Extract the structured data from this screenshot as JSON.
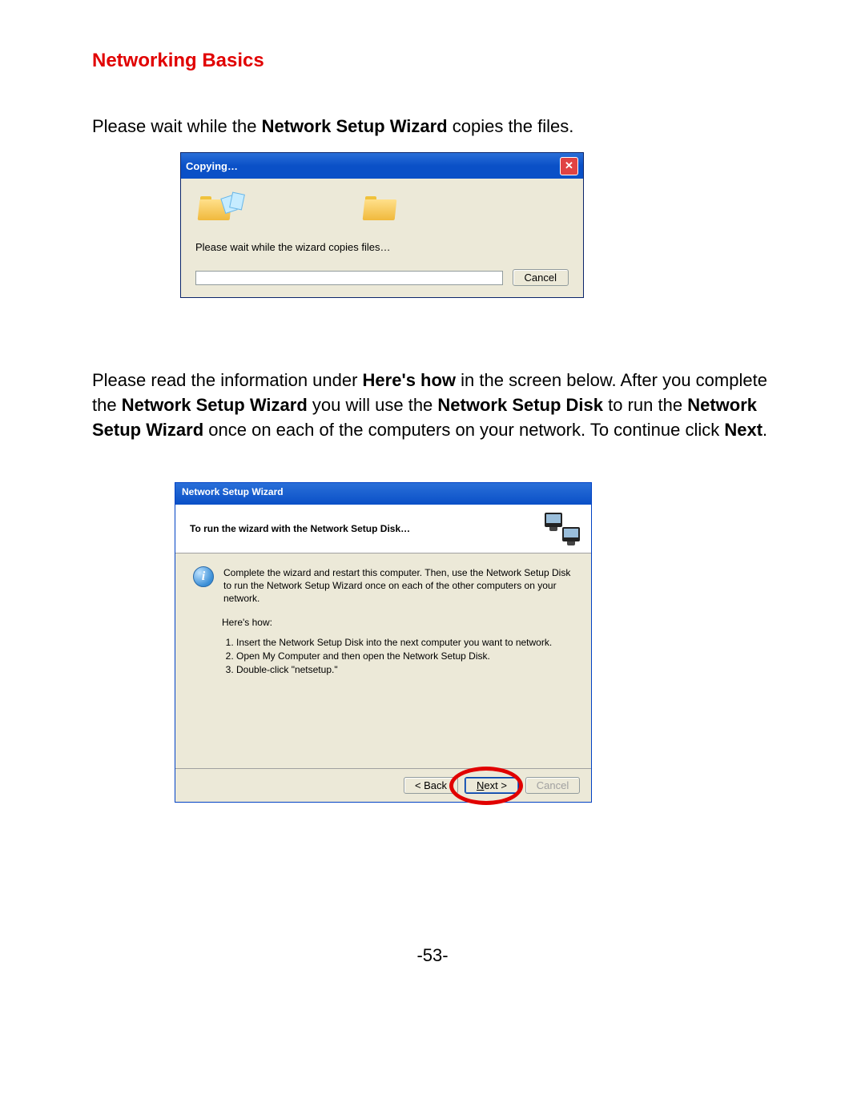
{
  "page": {
    "title": "Networking Basics",
    "para1_pre": "Please wait while the ",
    "para1_bold": "Network Setup Wizard",
    "para1_post": " copies the files.",
    "para2_a": "Please read the information under ",
    "para2_b": "Here's how",
    "para2_c": " in the screen below.    After you complete the ",
    "para2_d": "Network Setup Wizard",
    "para2_e": " you will use the ",
    "para2_f": "Network Setup Disk",
    "para2_g": " to run the ",
    "para2_h": "Network Setup Wizard",
    "para2_i": " once on each of the computers on your network.    To continue click ",
    "para2_j": "Next",
    "para2_k": ".",
    "page_number": "-53-"
  },
  "copy_dialog": {
    "title": "Copying…",
    "message": "Please wait while the wizard copies files…",
    "cancel": "Cancel"
  },
  "wizard_dialog": {
    "title": "Network Setup Wizard",
    "header": "To run the wizard with the Network Setup Disk…",
    "info_text": "Complete the wizard and restart this computer. Then, use the Network Setup Disk to run the Network Setup Wizard once on each of the other computers on your network.",
    "heres_how": "Here's how:",
    "steps": [
      "Insert the Network Setup Disk into the next computer you want to network.",
      "Open My Computer and then open the Network Setup Disk.",
      "Double-click \"netsetup.\""
    ],
    "back": "< Back",
    "next": "Next >",
    "cancel": "Cancel"
  }
}
